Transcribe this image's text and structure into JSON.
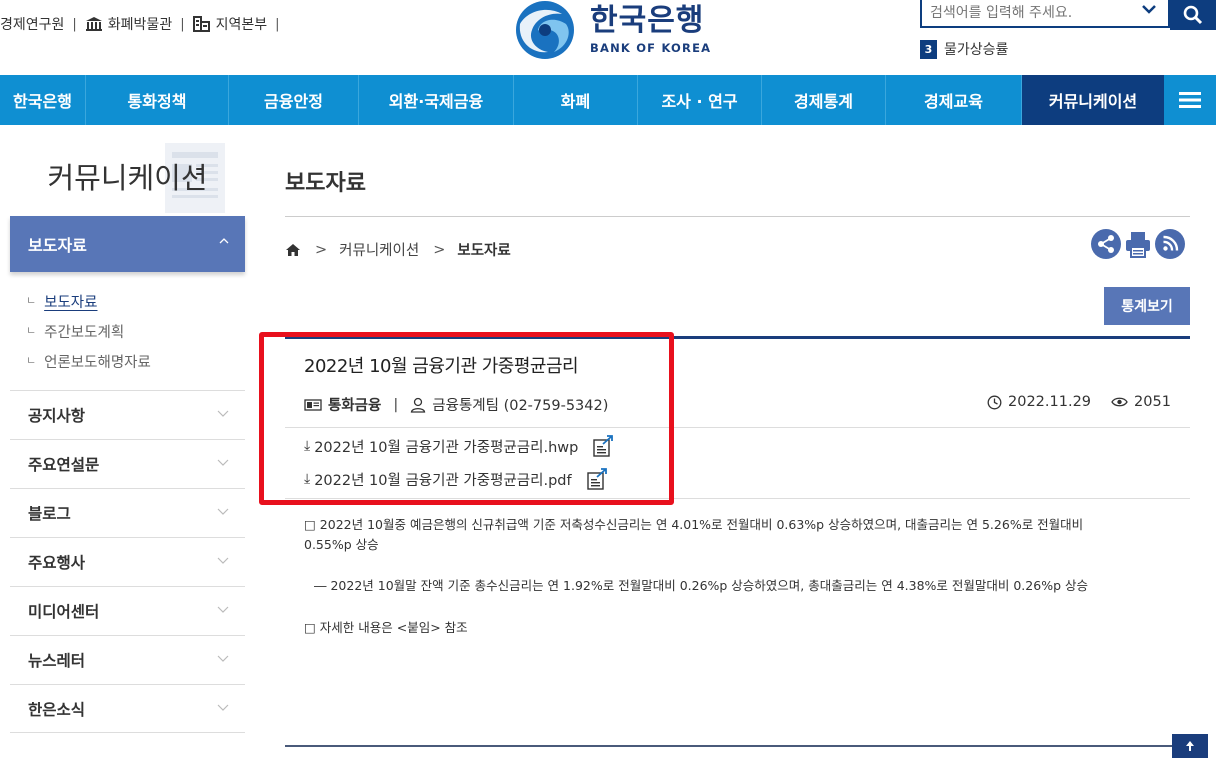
{
  "utility_links": [
    {
      "label": "경제연구원",
      "icon": ""
    },
    {
      "label": "화폐박물관",
      "icon": "museum-icon"
    },
    {
      "label": "지역본부",
      "icon": "region-icon"
    }
  ],
  "logo": {
    "korean": "한국은행",
    "english": "BANK OF KOREA"
  },
  "search": {
    "placeholder": "검색어를 입력해 주세요."
  },
  "trending": {
    "rank": "3",
    "keyword": "물가상승률"
  },
  "gnb": [
    {
      "label": "한국은행",
      "width": 0
    },
    {
      "label": "통화정책"
    },
    {
      "label": "금융안정"
    },
    {
      "label": "외환·국제금융"
    },
    {
      "label": "화폐"
    },
    {
      "label": "조사 · 연구"
    },
    {
      "label": "경제통계"
    },
    {
      "label": "경제교육"
    },
    {
      "label": "커뮤니케이션",
      "active": true
    }
  ],
  "sidebar": {
    "title": "커뮤니케이션",
    "active_section": "보도자료",
    "sub_items": [
      "보도자료",
      "주간보도계획",
      "언론보도해명자료"
    ],
    "items": [
      "공지사항",
      "주요연설문",
      "블로그",
      "주요행사",
      "미디어센터",
      "뉴스레터",
      "한은소식"
    ]
  },
  "content": {
    "page_title": "보도자료",
    "breadcrumb": [
      "커뮤니케이션",
      "보도자료"
    ],
    "stats_button": "통계보기",
    "post": {
      "title": "2022년 10월 금융기관 가중평균금리",
      "category": "통화금융",
      "department": "금융통계팀  (02-759-5342)",
      "date": "2022.11.29",
      "views": "2051",
      "files": [
        "2022년 10월 금융기관 가중평균금리.hwp",
        "2022년 10월 금융기관 가중평균금리.pdf"
      ]
    },
    "body": {
      "p1": "□  2022년 10월중 예금은행의 신규취급액 기준 저축성수신금리는 연 4.01%로 전월대비 0.63%p 상승하였으며, 대출금리는 연 5.26%로 전월대비",
      "p1b": "0.55%p 상승",
      "p2": "― 2022년 10월말 잔액 기준 총수신금리는 연 1.92%로 전월말대비 0.26%p 상승하였으며, 총대출금리는 연 4.38%로 전월말대비 0.26%p 상승",
      "p3": "□ 자세한 내용은 <붙임> 참조"
    }
  },
  "colors": {
    "gnb_blue": "#0f8fd2",
    "navy": "#0d3d7f",
    "side_active": "#5876b7",
    "highlight_red": "#e8101d"
  }
}
